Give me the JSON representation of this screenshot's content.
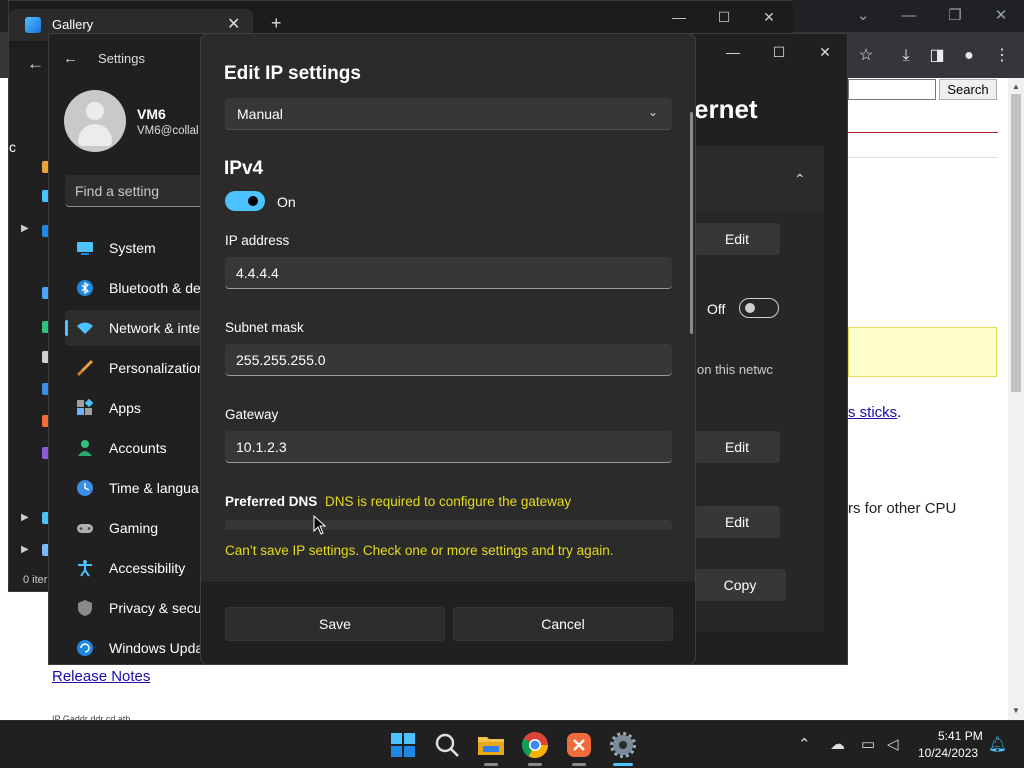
{
  "browser": {
    "search_button": "Search",
    "link_sticks": "s sticks",
    "link_period": ".",
    "text_cpu": "rs for other CPU",
    "release_notes": "Release Notes",
    "cutoff_text": "IP Gaddr ddr cd atb"
  },
  "gallery": {
    "tab_title": "Gallery",
    "status": "0 iter",
    "char": "c"
  },
  "settings": {
    "title": "Settings",
    "user_name": "VM6",
    "user_email": "VM6@collal",
    "search_placeholder": "Find a setting",
    "heading": "ernet",
    "nav": [
      {
        "label": "System",
        "icon": "monitor-icon"
      },
      {
        "label": "Bluetooth & de",
        "icon": "bluetooth-icon"
      },
      {
        "label": "Network & inte",
        "icon": "wifi-icon"
      },
      {
        "label": "Personalization",
        "icon": "brush-icon"
      },
      {
        "label": "Apps",
        "icon": "apps-icon"
      },
      {
        "label": "Accounts",
        "icon": "person-icon"
      },
      {
        "label": "Time & langua",
        "icon": "clock-globe-icon"
      },
      {
        "label": "Gaming",
        "icon": "gamepad-icon"
      },
      {
        "label": "Accessibility",
        "icon": "accessibility-icon"
      },
      {
        "label": "Privacy & secu",
        "icon": "shield-icon"
      },
      {
        "label": "Windows Upda",
        "icon": "update-icon"
      }
    ],
    "right": {
      "edit_1": "Edit",
      "off_label": "Off",
      "network_text": "on this netwc",
      "edit_2": "Edit",
      "edit_3": "Edit",
      "copy": "Copy"
    }
  },
  "dialog": {
    "title": "Edit IP settings",
    "mode": "Manual",
    "ipv4_heading": "IPv4",
    "ipv4_state": "On",
    "ip_label": "IP address",
    "ip_value": "4.4.4.4",
    "subnet_label": "Subnet mask",
    "subnet_value": "255.255.255.0",
    "gateway_label": "Gateway",
    "gateway_value": "10.1.2.3",
    "dns_label": "Preferred DNS",
    "dns_error": "DNS is required to configure the gateway",
    "save_error": "Can’t save IP settings. Check one or more settings and try again.",
    "save": "Save",
    "cancel": "Cancel"
  },
  "taskbar": {
    "time": "5:41 PM",
    "date": "10/24/2023",
    "apps": [
      "start-icon",
      "search-icon",
      "file-explorer-icon",
      "chrome-icon",
      "xampp-icon",
      "settings-gear-icon"
    ]
  },
  "colors": {
    "accent": "#4cc2ff",
    "warning": "#e6dc1d",
    "dark_bg": "#202020",
    "dialog_bg": "#2b2b2b"
  }
}
